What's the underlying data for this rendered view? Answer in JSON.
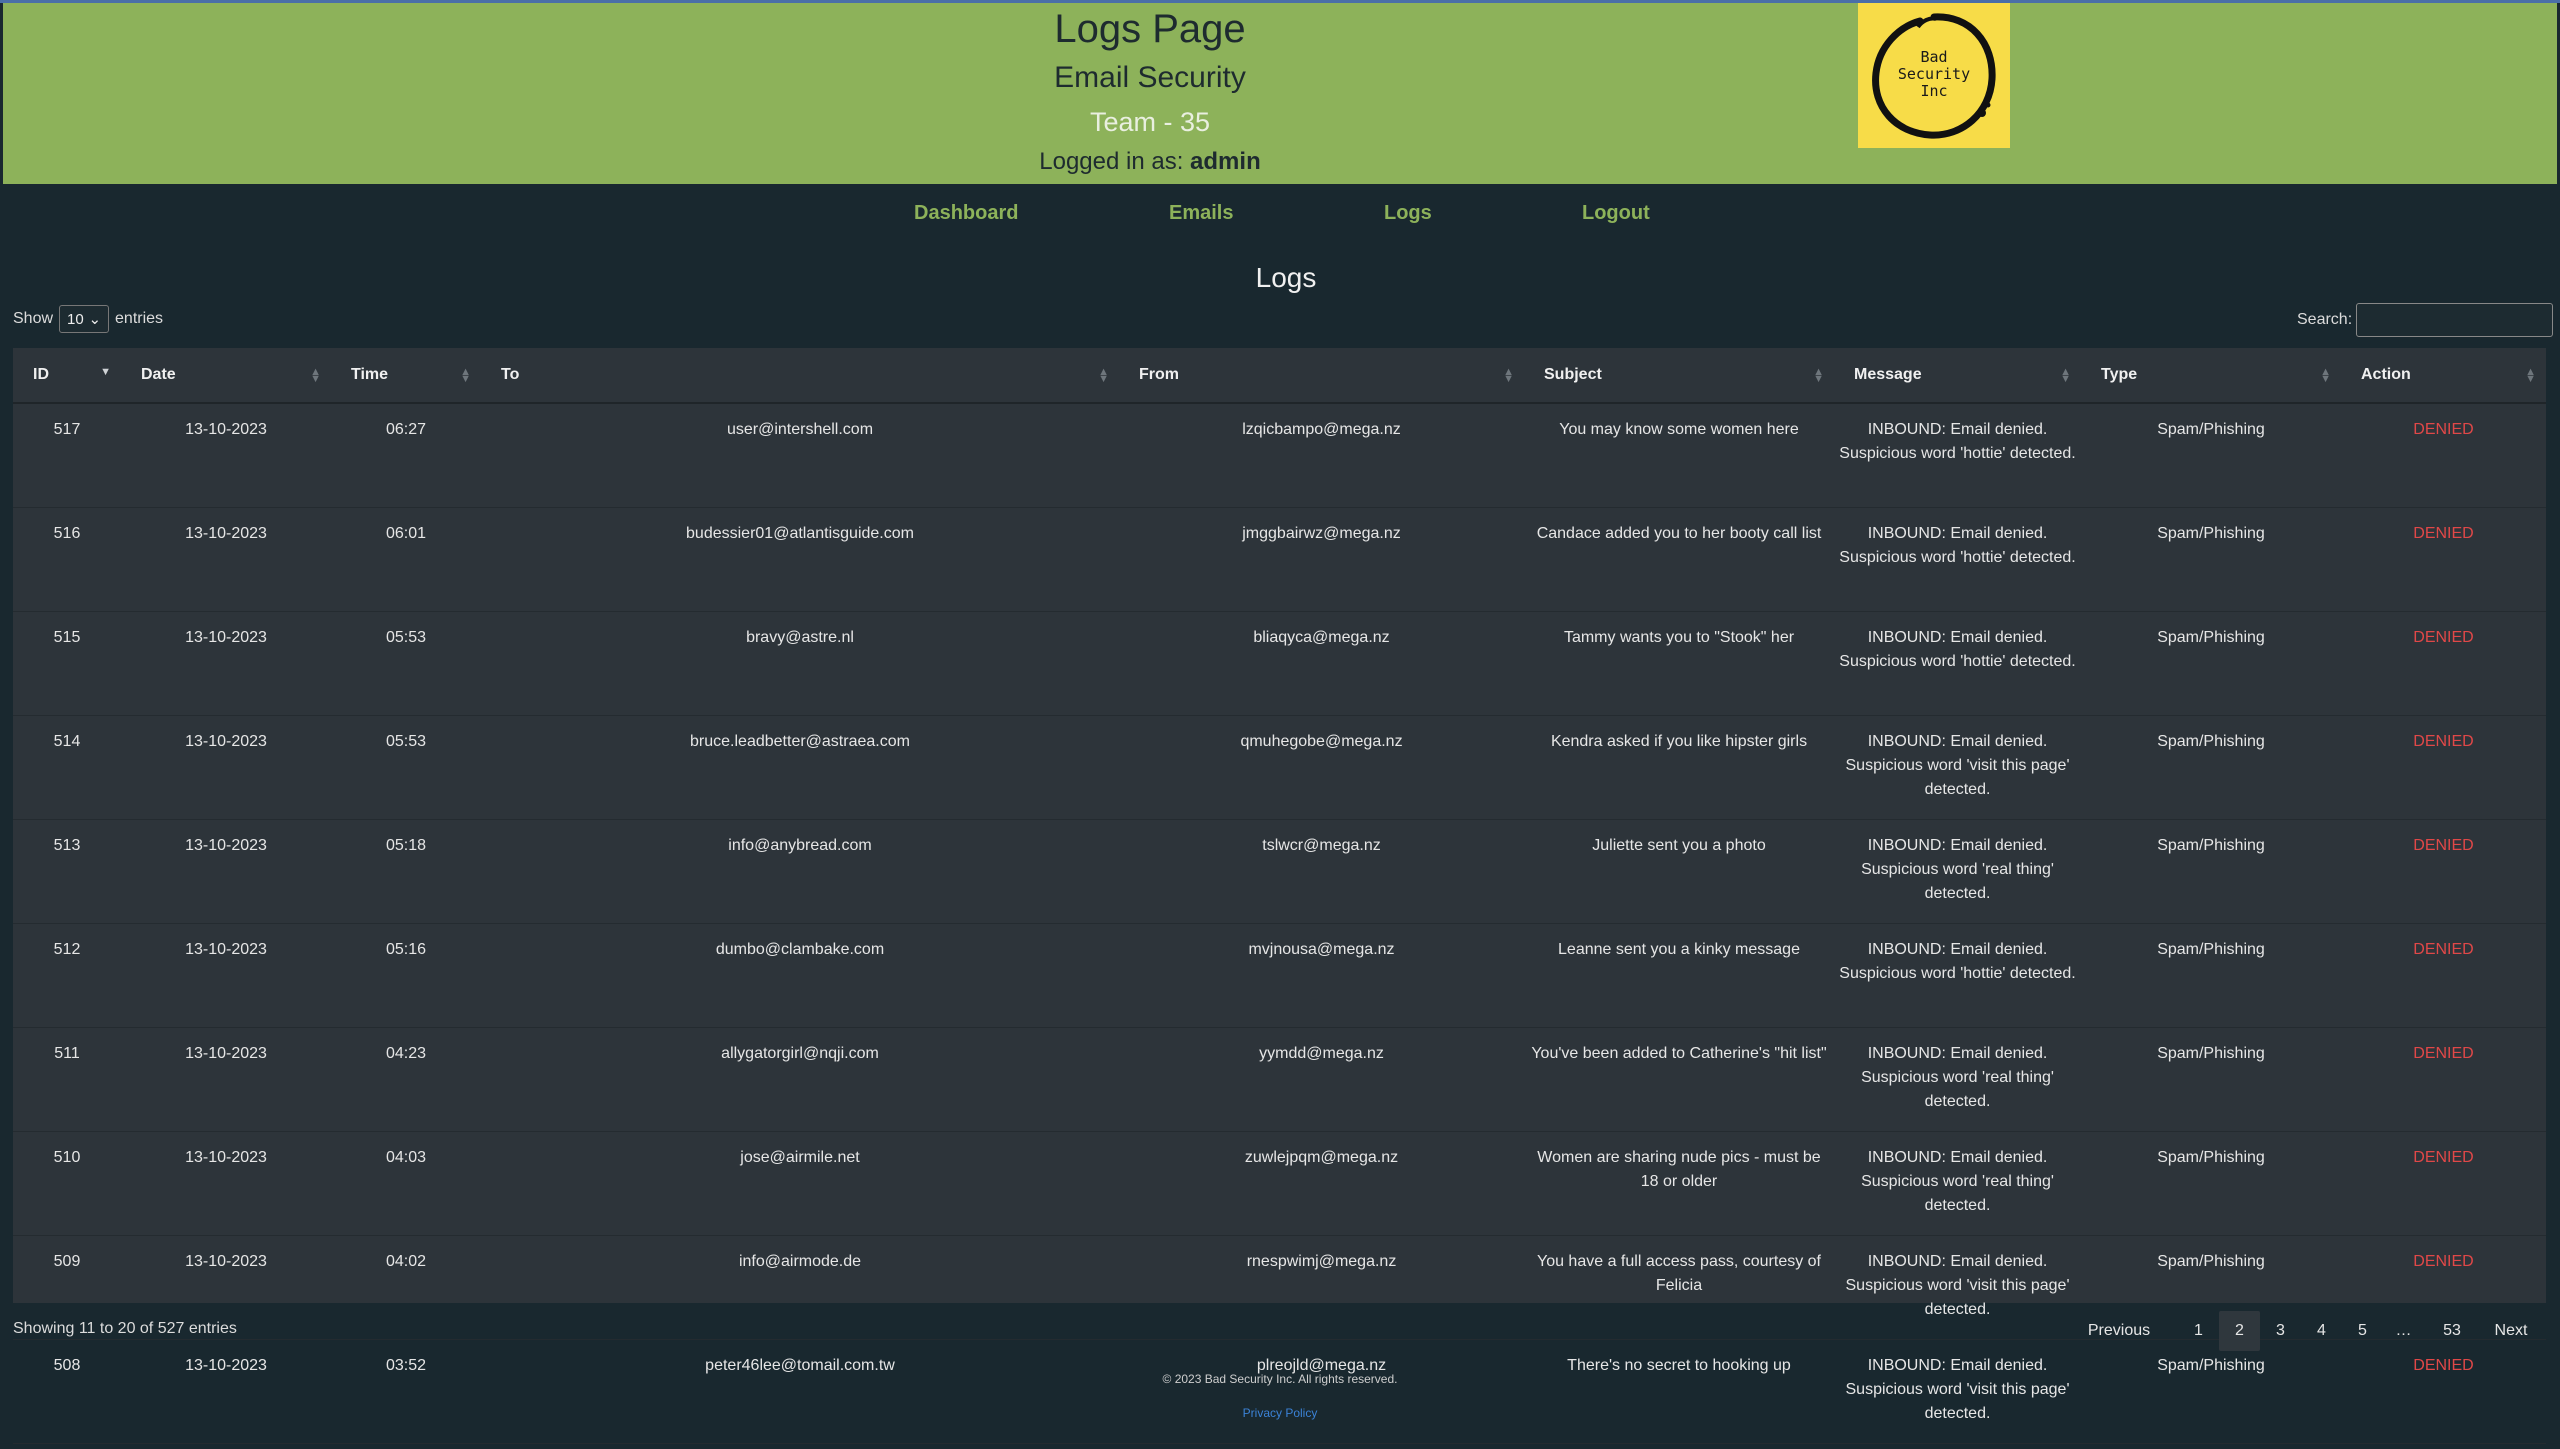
{
  "header": {
    "title": "Logs Page",
    "subtitle": "Email Security",
    "team": "Team - 35",
    "logged_in_label": "Logged in as:",
    "user": "admin",
    "logo_text": [
      "Bad",
      "Security",
      "Inc"
    ]
  },
  "nav": [
    "Dashboard",
    "Emails",
    "Logs",
    "Logout"
  ],
  "page_heading": "Logs",
  "controls": {
    "show_label": "Show",
    "entries_value": "10",
    "entries_label": "entries",
    "search_label": "Search:",
    "search_value": ""
  },
  "table": {
    "columns": [
      "ID",
      "Date",
      "Time",
      "To",
      "From",
      "Subject",
      "Message",
      "Type",
      "Action"
    ],
    "rows": [
      [
        "517",
        "13-10-2023",
        "06:27",
        "user@intershell.com",
        "lzqicbampo@mega.nz",
        "You may know some women here",
        "INBOUND: Email denied. Suspicious word 'hottie' detected.",
        "Spam/Phishing",
        "DENIED"
      ],
      [
        "516",
        "13-10-2023",
        "06:01",
        "budessier01@atlantisguide.com",
        "jmggbairwz@mega.nz",
        "Candace added you to her booty call list",
        "INBOUND: Email denied. Suspicious word 'hottie' detected.",
        "Spam/Phishing",
        "DENIED"
      ],
      [
        "515",
        "13-10-2023",
        "05:53",
        "bravy@astre.nl",
        "bliaqyca@mega.nz",
        "Tammy wants you to \"Stook\" her",
        "INBOUND: Email denied. Suspicious word 'hottie' detected.",
        "Spam/Phishing",
        "DENIED"
      ],
      [
        "514",
        "13-10-2023",
        "05:53",
        "bruce.leadbetter@astraea.com",
        "qmuhegobe@mega.nz",
        "Kendra asked if you like hipster girls",
        "INBOUND: Email denied. Suspicious word 'visit this page' detected.",
        "Spam/Phishing",
        "DENIED"
      ],
      [
        "513",
        "13-10-2023",
        "05:18",
        "info@anybread.com",
        "tslwcr@mega.nz",
        "Juliette sent you a photo",
        "INBOUND: Email denied. Suspicious word 'real thing' detected.",
        "Spam/Phishing",
        "DENIED"
      ],
      [
        "512",
        "13-10-2023",
        "05:16",
        "dumbo@clambake.com",
        "mvjnousa@mega.nz",
        "Leanne sent you a kinky message",
        "INBOUND: Email denied. Suspicious word 'hottie' detected.",
        "Spam/Phishing",
        "DENIED"
      ],
      [
        "511",
        "13-10-2023",
        "04:23",
        "allygatorgirl@nqji.com",
        "yymdd@mega.nz",
        "You've been added to Catherine's \"hit list\"",
        "INBOUND: Email denied. Suspicious word 'real thing' detected.",
        "Spam/Phishing",
        "DENIED"
      ],
      [
        "510",
        "13-10-2023",
        "04:03",
        "jose@airmile.net",
        "zuwlejpqm@mega.nz",
        "Women are sharing nude pics - must be 18 or older",
        "INBOUND: Email denied. Suspicious word 'real thing' detected.",
        "Spam/Phishing",
        "DENIED"
      ],
      [
        "509",
        "13-10-2023",
        "04:02",
        "info@airmode.de",
        "rnespwimj@mega.nz",
        "You have a full access pass, courtesy of Felicia",
        "INBOUND: Email denied. Suspicious word 'visit this page' detected.",
        "Spam/Phishing",
        "DENIED"
      ],
      [
        "508",
        "13-10-2023",
        "03:52",
        "peter46lee@tomail.com.tw",
        "plreojld@mega.nz",
        "There's no secret to hooking up",
        "INBOUND: Email denied. Suspicious word 'visit this page' detected.",
        "Spam/Phishing",
        "DENIED"
      ]
    ]
  },
  "info": "Showing 11 to 20 of 527 entries",
  "pagination": [
    "Previous",
    "1",
    "2",
    "3",
    "4",
    "5",
    "…",
    "53",
    "Next"
  ],
  "pagination_current": "2",
  "footer": {
    "copyright": "© 2023 Bad Security Inc. All rights reserved.",
    "privacy": "Privacy Policy"
  },
  "colors": {
    "header_bg": "#8db25a",
    "page_bg": "#19282f",
    "table_bg": "#2d343a",
    "denied": "#e04848",
    "logo_bg": "#f7dc48"
  }
}
